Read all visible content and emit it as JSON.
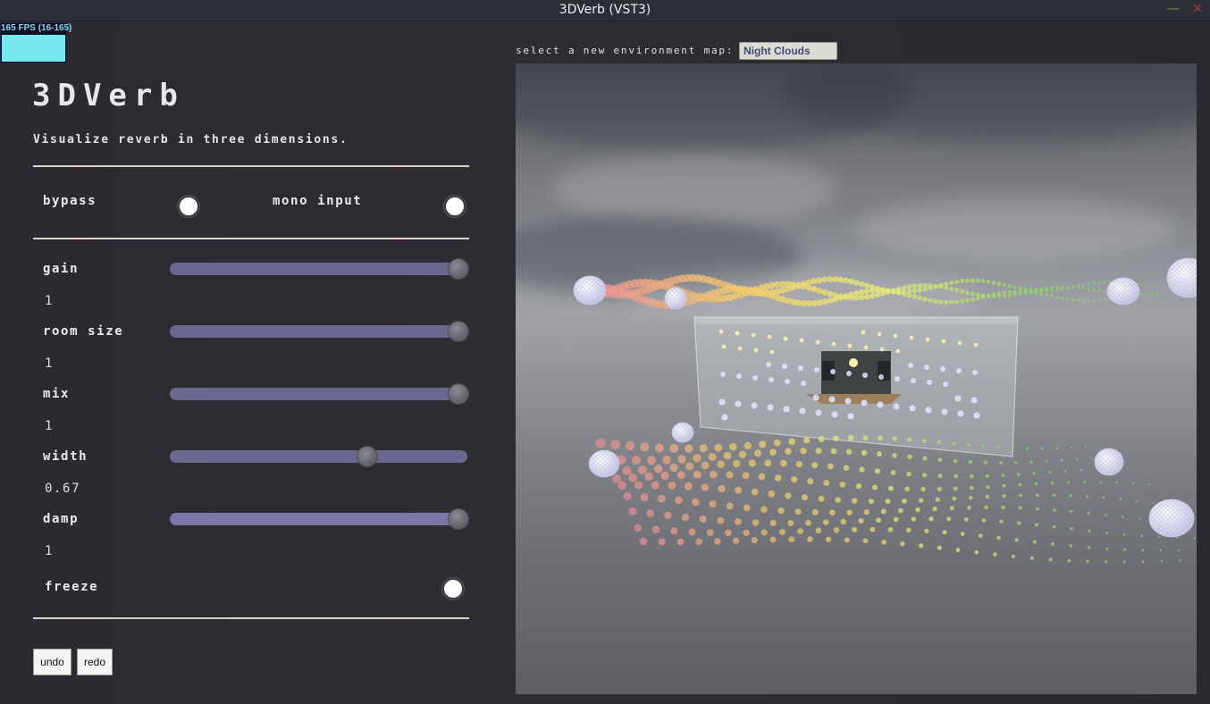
{
  "window": {
    "title": "3DVerb (VST3)",
    "minimize_glyph": "—",
    "close_glyph": "✕"
  },
  "fps": {
    "label": "165 FPS (16-165)",
    "graph_color": "#78e8f0"
  },
  "app": {
    "title": "3DVerb",
    "subtitle": "Visualize reverb in three dimensions."
  },
  "toggles": {
    "bypass": {
      "label": "bypass",
      "on": false
    },
    "mono_input": {
      "label": "mono input",
      "on": false
    },
    "freeze": {
      "label": "freeze",
      "on": false
    }
  },
  "sliders": {
    "gain": {
      "label": "gain",
      "value": "1",
      "fraction": 1.0
    },
    "room_size": {
      "label": "room size",
      "value": "1",
      "fraction": 1.0
    },
    "mix": {
      "label": "mix",
      "value": "1",
      "fraction": 1.0
    },
    "width": {
      "label": "width",
      "value": "0.67",
      "fraction": 0.67
    },
    "damp": {
      "label": "damp",
      "value": "1",
      "fraction": 1.0
    }
  },
  "buttons": {
    "undo": "undo",
    "redo": "redo"
  },
  "environment": {
    "label": "select a new environment map:",
    "selected": "Night Clouds"
  },
  "colors": {
    "panel_bg": "#2b2a30",
    "slider_track": "#6b6890",
    "slider_thumb": "#6e6d75",
    "divider": "#d8d4c6",
    "fps_bg": "#0e0e22"
  }
}
